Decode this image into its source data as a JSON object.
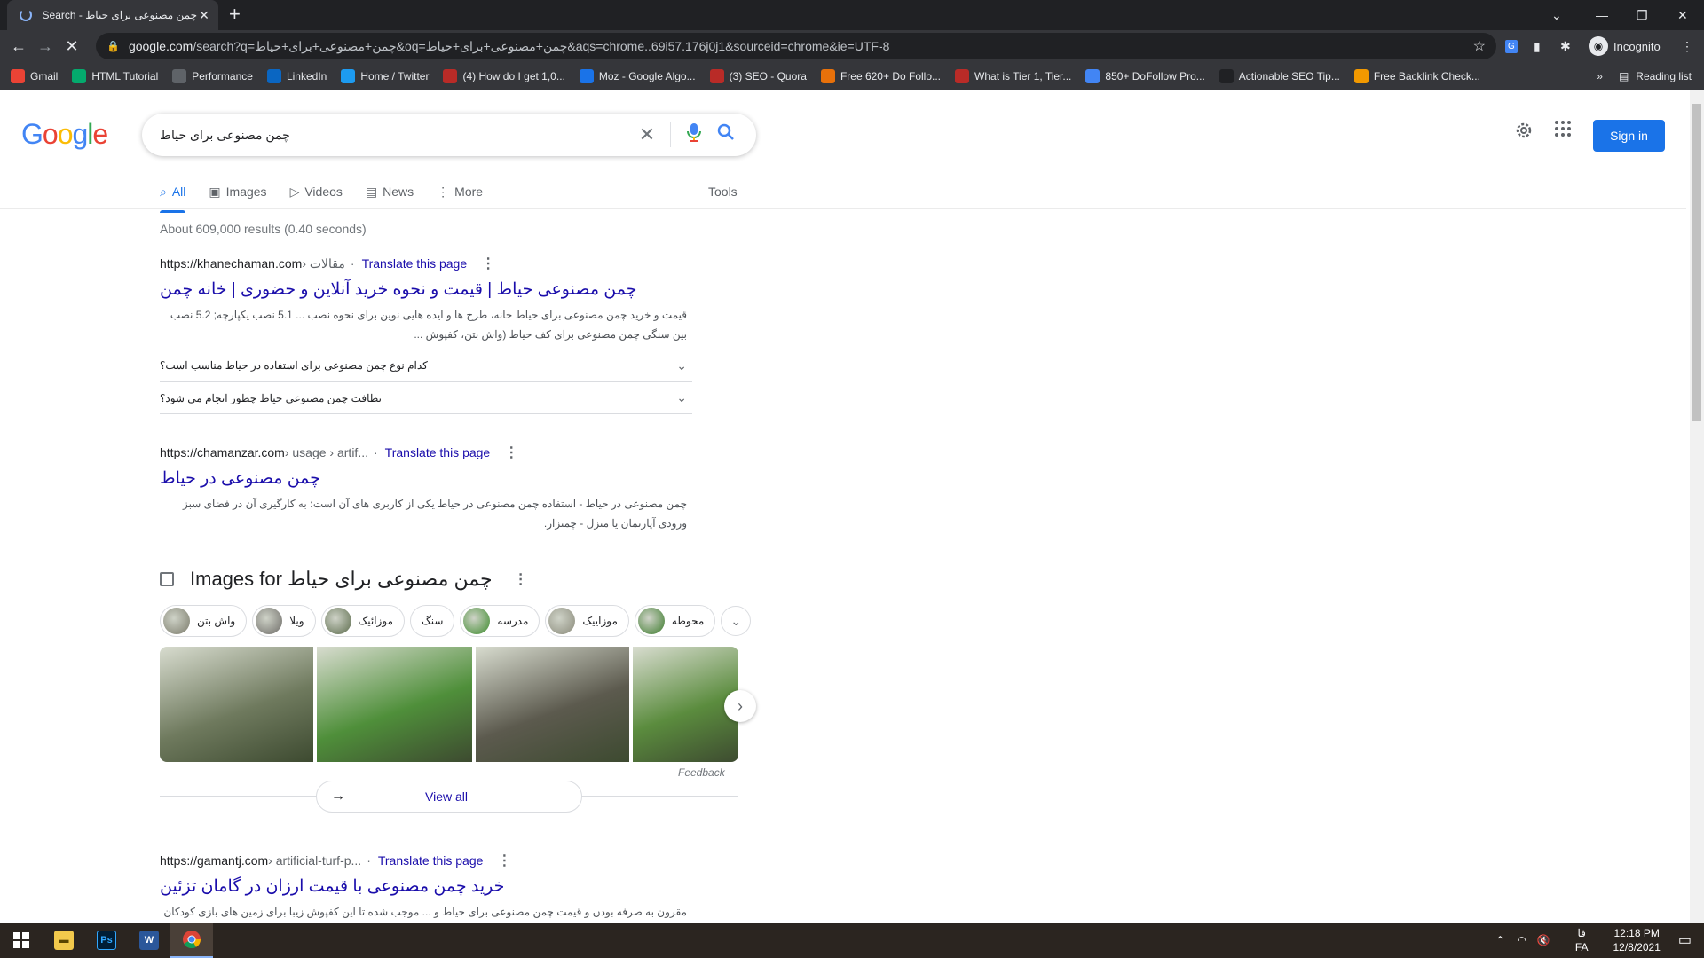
{
  "browser": {
    "tab_title": "چمن مصنوعی برای حیاط - Google Search",
    "url_domain": "google.com",
    "url_rest": "/search?q=چمن+مصنوعی+برای+حیاط&oq=چمن+مصنوعی+برای+حیاط&aqs=chrome..69i57.176j0j1&sourceid=chrome&ie=UTF-8",
    "incognito_label": "Incognito",
    "reading_list_label": "Reading list",
    "bookmarks": [
      {
        "label": "Gmail",
        "icon": "gmail-icon",
        "color": "#ea4335"
      },
      {
        "label": "HTML Tutorial",
        "icon": "w3schools-icon",
        "color": "#04aa6d"
      },
      {
        "label": "Performance",
        "icon": "performance-icon",
        "color": "#5f6368"
      },
      {
        "label": "LinkedIn",
        "icon": "linkedin-icon",
        "color": "#0a66c2"
      },
      {
        "label": "Home / Twitter",
        "icon": "twitter-icon",
        "color": "#1d9bf0"
      },
      {
        "label": "(4) How do I get 1,0...",
        "icon": "quora-icon",
        "color": "#b92b27"
      },
      {
        "label": "Moz - Google Algo...",
        "icon": "moz-icon",
        "color": "#1a73e8"
      },
      {
        "label": "(3) SEO - Quora",
        "icon": "quora-icon",
        "color": "#b92b27"
      },
      {
        "label": "Free 620+ Do Follo...",
        "icon": "site-icon",
        "color": "#e8710a"
      },
      {
        "label": "What is Tier 1, Tier...",
        "icon": "quora-icon",
        "color": "#b92b27"
      },
      {
        "label": "850+ DoFollow Pro...",
        "icon": "site-icon",
        "color": "#4285f4"
      },
      {
        "label": "Actionable SEO Tip...",
        "icon": "seo-icon",
        "color": "#202124"
      },
      {
        "label": "Free Backlink Check...",
        "icon": "site-icon",
        "color": "#f29900"
      }
    ]
  },
  "google": {
    "logo": "Google",
    "query": "چمن مصنوعی برای حیاط",
    "signin_label": "Sign in",
    "tabs": [
      {
        "label": "All",
        "icon": "search-icon"
      },
      {
        "label": "Images",
        "icon": "image-icon"
      },
      {
        "label": "Videos",
        "icon": "video-icon"
      },
      {
        "label": "News",
        "icon": "news-icon"
      },
      {
        "label": "More",
        "icon": "more-vert-icon"
      }
    ],
    "tools_label": "Tools",
    "stats": "About 609,000 results (0.40 seconds)"
  },
  "results": [
    {
      "site": "https://khanechaman.com",
      "path": " › مقالات",
      "translate": "Translate this page",
      "title": "چمن مصنوعی حیاط | قیمت و نحوه خرید آنلاین و حضوری | خانه چمن",
      "snippet": "قیمت و خرید چمن مصنوعی برای حیاط خانه، طرح ها و ایده هایی نوین برای نحوه نصب ... 5.1 نصب یکپارچه; 5.2 نصب بین سنگی چمن مصنوعی برای کف حیاط (واش بتن، کفپوش ..."
    },
    {
      "site": "https://chamanzar.com",
      "path": " › usage › artif...",
      "translate": "Translate this page",
      "title": "چمن مصنوعی در حیاط",
      "snippet": "چمن مصنوعی در حیاط - استفاده چمن مصنوعی در حیاط یکی از کاربری های آن است؛ به کارگیری آن در فضای سبز ورودی آپارتمان یا منزل - چمنزار."
    },
    {
      "site": "https://gamantj.com",
      "path": " › artificial-turf-p...",
      "translate": "Translate this page",
      "title": "خرید چمن مصنوعی با قیمت ارزان در گامان تزئین",
      "snippet": "مقرون به صرفه بودن و قیمت چمن مصنوعی برای حیاط و ... موجب شده تا این کفپوش زیبا برای زمین های بازی کودکان و زمین"
    }
  ],
  "faqs": [
    "کدام نوع چمن مصنوعی برای استفاده در حیاط مناسب است؟",
    "نظافت چمن مصنوعی حیاط چطور انجام می شود؟"
  ],
  "images": {
    "heading_prefix": "Images for",
    "heading_query": "چمن مصنوعی برای حیاط",
    "chips": [
      {
        "label": "واش بتن",
        "thumb": "#7a7a6a"
      },
      {
        "label": "ویلا",
        "thumb": "#6c6a66"
      },
      {
        "label": "موزائیک",
        "thumb": "#5a6a4a"
      },
      {
        "label": "سنگ",
        "thumb": ""
      },
      {
        "label": "مدرسه",
        "thumb": "#3b8a2a"
      },
      {
        "label": "موزاییک",
        "thumb": "#8a8a7a"
      },
      {
        "label": "محوطه",
        "thumb": "#3a7a2a"
      }
    ],
    "thumbs": [
      "#6f7a5e",
      "#4f8f3a",
      "#5c5a4e",
      "#5b8c3e"
    ],
    "feedback": "Feedback",
    "view_all": "View all"
  },
  "taskbar": {
    "time": "12:18 PM",
    "date": "12/8/2021",
    "lang_top": "فا",
    "lang_bottom": "FA"
  }
}
